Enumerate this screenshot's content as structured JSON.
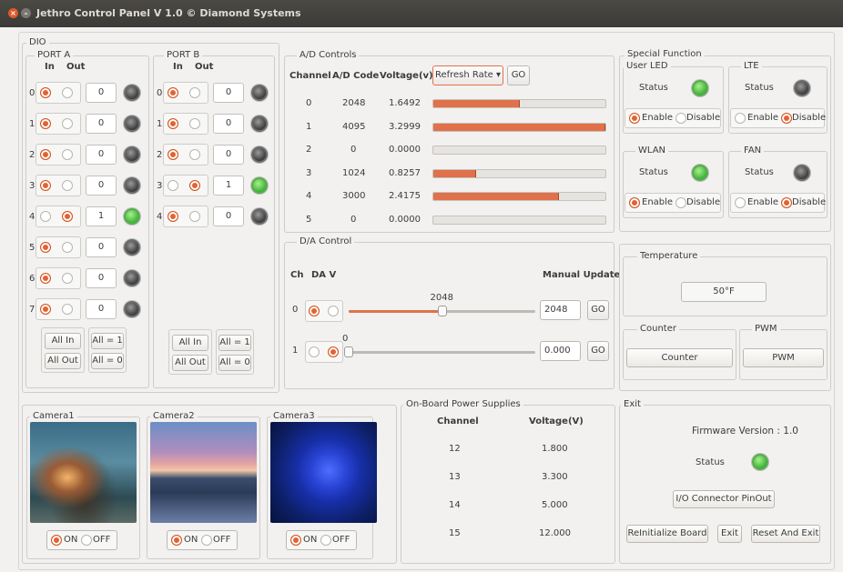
{
  "window": {
    "title": "Jethro Control Panel V 1.0 © Diamond Systems"
  },
  "dio": {
    "title": "DIO",
    "port_a": {
      "title": "PORT A",
      "in_label": "In",
      "out_label": "Out",
      "rows": [
        {
          "idx": "0",
          "value": "0",
          "led": "off",
          "dir": "in"
        },
        {
          "idx": "1",
          "value": "0",
          "led": "off",
          "dir": "in"
        },
        {
          "idx": "2",
          "value": "0",
          "led": "off",
          "dir": "in"
        },
        {
          "idx": "3",
          "value": "0",
          "led": "off",
          "dir": "in"
        },
        {
          "idx": "4",
          "value": "1",
          "led": "on",
          "dir": "out"
        },
        {
          "idx": "5",
          "value": "0",
          "led": "off",
          "dir": "in"
        },
        {
          "idx": "6",
          "value": "0",
          "led": "off",
          "dir": "in"
        },
        {
          "idx": "7",
          "value": "0",
          "led": "off",
          "dir": "in"
        }
      ]
    },
    "port_b": {
      "title": "PORT B",
      "in_label": "In",
      "out_label": "Out",
      "rows": [
        {
          "idx": "0",
          "value": "0",
          "led": "off",
          "dir": "in"
        },
        {
          "idx": "1",
          "value": "0",
          "led": "off",
          "dir": "in"
        },
        {
          "idx": "2",
          "value": "0",
          "led": "off",
          "dir": "in"
        },
        {
          "idx": "3",
          "value": "1",
          "led": "on",
          "dir": "out"
        },
        {
          "idx": "4",
          "value": "0",
          "led": "off",
          "dir": "in"
        }
      ]
    },
    "buttons": {
      "all_in": "All In",
      "all_out": "All Out",
      "all_1": "All = 1",
      "all_0": "All = 0"
    }
  },
  "ad": {
    "title": "A/D Controls",
    "headers": {
      "channel": "Channel",
      "code": "A/D Code",
      "voltage": "Voltage(v)"
    },
    "refresh_label": "Refresh Rate ▾",
    "go": "GO",
    "rows": [
      {
        "ch": "0",
        "code": "2048",
        "volt": "1.6492",
        "level": 0.5
      },
      {
        "ch": "1",
        "code": "4095",
        "volt": "3.2999",
        "level": 1.0
      },
      {
        "ch": "2",
        "code": "0",
        "volt": "0.0000",
        "level": 0.0
      },
      {
        "ch": "3",
        "code": "1024",
        "volt": "0.8257",
        "level": 0.25
      },
      {
        "ch": "4",
        "code": "3000",
        "volt": "2.4175",
        "level": 0.73
      },
      {
        "ch": "5",
        "code": "0",
        "volt": "0.0000",
        "level": 0.0
      }
    ]
  },
  "da": {
    "title": "D/A Control",
    "headers": {
      "ch": "Ch",
      "dav": "DA V",
      "manual": "Manual Update"
    },
    "rows": [
      {
        "ch": "0",
        "slider_label": "2048",
        "level": 0.5,
        "value": "2048",
        "go": "GO",
        "sel": "left"
      },
      {
        "ch": "1",
        "slider_label": "0",
        "level": 0.0,
        "value": "0.000",
        "go": "GO",
        "sel": "right"
      }
    ]
  },
  "special": {
    "title": "Special Function",
    "status_label": "Status",
    "enable": "Enable",
    "disable": "Disable",
    "user_led": {
      "title": "User LED",
      "led": "on",
      "mode": "enable"
    },
    "lte": {
      "title": "LTE",
      "led": "off",
      "mode": "disable"
    },
    "wlan": {
      "title": "WLAN",
      "led": "on",
      "mode": "enable"
    },
    "fan": {
      "title": "FAN",
      "led": "off",
      "mode": "disable"
    }
  },
  "temperature": {
    "title": "Temperature",
    "value": "50°F"
  },
  "counter": {
    "title": "Counter",
    "button": "Counter"
  },
  "pwm": {
    "title": "PWM",
    "button": "PWM"
  },
  "cameras": [
    {
      "title": "Camera1",
      "on": "ON",
      "off": "OFF",
      "state": "on"
    },
    {
      "title": "Camera2",
      "on": "ON",
      "off": "OFF",
      "state": "on"
    },
    {
      "title": "Camera3",
      "on": "ON",
      "off": "OFF",
      "state": "on"
    }
  ],
  "power": {
    "title": "On-Board Power Supplies",
    "headers": {
      "channel": "Channel",
      "voltage": "Voltage(V)"
    },
    "rows": [
      {
        "ch": "12",
        "v": "1.800"
      },
      {
        "ch": "13",
        "v": "3.300"
      },
      {
        "ch": "14",
        "v": "5.000"
      },
      {
        "ch": "15",
        "v": "12.000"
      }
    ]
  },
  "exit": {
    "title": "Exit",
    "firmware": "Firmware Version : 1.0",
    "status": "Status",
    "pinout": "I/O Connector PinOut",
    "reinit": "ReInitialize Board",
    "exit": "Exit",
    "reset_exit": "Reset And Exit"
  },
  "colors": {
    "accent": "#e0714a",
    "led_on": "#3fb53a",
    "led_off": "#4a4a4a"
  }
}
